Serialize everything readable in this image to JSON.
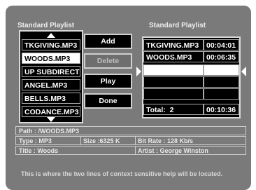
{
  "left_header": "Standard Playlist",
  "right_header": "Standard Playlist",
  "files": [
    "TKGIVING.MP3",
    "WOODS.MP3",
    "UP SUBDIRECT",
    "ANGEL.MP3",
    "BELLS.MP3",
    "CODANCE.MP3"
  ],
  "selected_file_index": 1,
  "buttons": {
    "add": "Add",
    "delete": "Delete",
    "play": "Play",
    "done": "Done"
  },
  "playlist": [
    {
      "name": "TKGIVING.MP3",
      "time": "00:04:01"
    },
    {
      "name": "WOODS.MP3",
      "time": "00:06:35"
    }
  ],
  "total": {
    "label": "Total:",
    "count": "2",
    "time": "00:10:36"
  },
  "info": {
    "path": "Path : /WOODS.MP3",
    "type": "Type : MP3",
    "size": "Size :6325 K",
    "bitrate": "Bit Rate : 128 Kb/s",
    "title": "Title : Woods",
    "artist": "Artist : George Winston"
  },
  "help_text": "This is where the two lines of context sensitive help will be located."
}
